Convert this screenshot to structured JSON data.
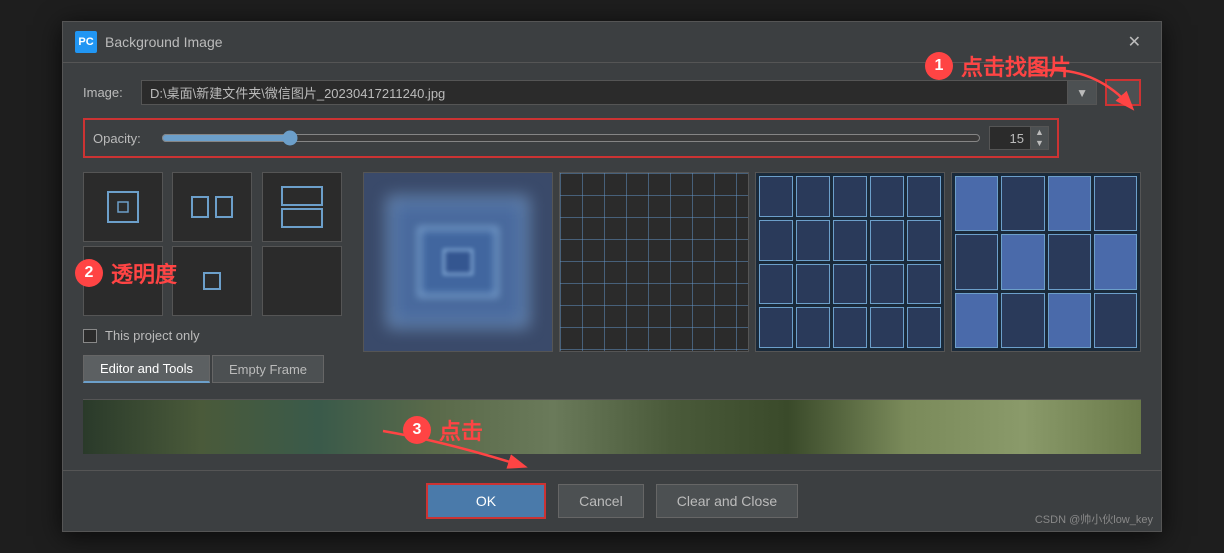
{
  "dialog": {
    "title": "Background Image",
    "app_icon": "PC",
    "close_label": "✕"
  },
  "image_row": {
    "label": "Image:",
    "path": "D:\\桌面\\新建文件夹\\微信图片_20230417211240.jpg",
    "dropdown_icon": "▼",
    "browse_label": "..."
  },
  "opacity_row": {
    "label": "Opacity:",
    "value": "15",
    "slider_value": 15
  },
  "annotations": {
    "ann1_number": "1",
    "ann1_text": "点击找图片",
    "ann2_number": "2",
    "ann2_text": "透明度",
    "ann3_number": "3",
    "ann3_text": "点击"
  },
  "checkbox": {
    "label": "This project only"
  },
  "tabs": {
    "tab1_label": "Editor and Tools",
    "tab2_label": "Empty Frame"
  },
  "buttons": {
    "ok_label": "OK",
    "cancel_label": "Cancel",
    "clear_label": "Clear and Close"
  },
  "watermark": "CSDN @帅小伙low_key"
}
